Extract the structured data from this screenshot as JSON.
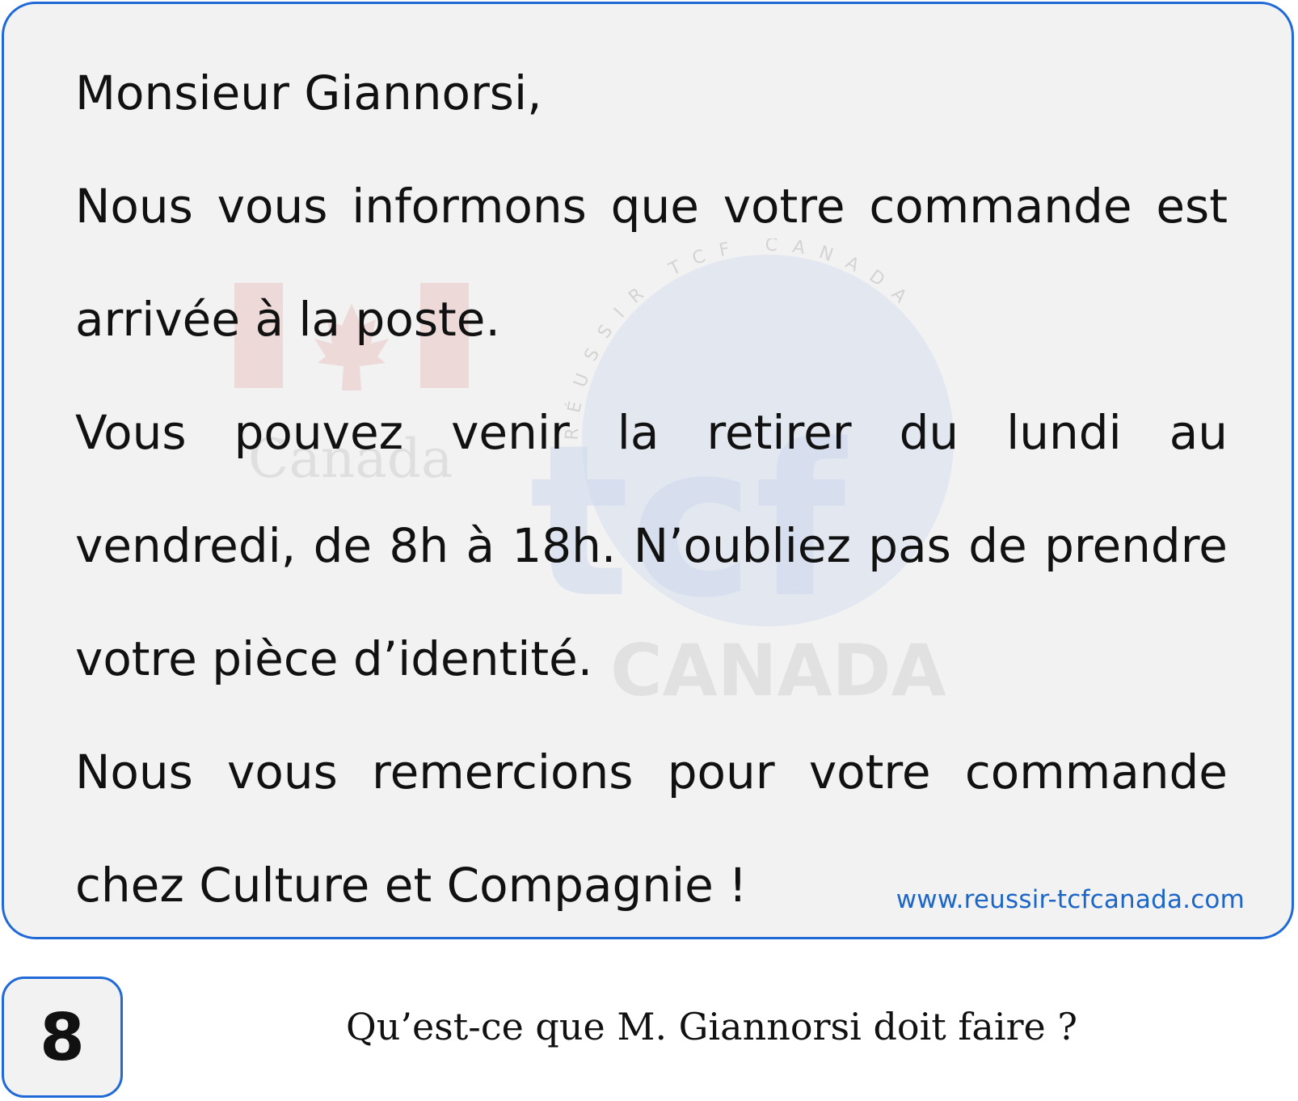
{
  "letter": {
    "greeting": "Monsieur Giannorsi,",
    "paragraph1": "Nous vous informons que votre commande est arrivée à la poste.",
    "paragraph2": "Vous pouvez venir la retirer du lundi au vendredi, de 8h à 18h. N’oubliez pas de prendre votre pièce d’identité.",
    "paragraph3": "Nous vous remercions pour votre commande chez Culture et Compagnie !"
  },
  "website": "www.reussir-tcfcanada.com",
  "watermark": {
    "canada_wordmark": "Canada",
    "logo_text": "tcf",
    "logo_subtext": "CANADA",
    "ring_text": "RÉUSSIR TCF CANADA"
  },
  "question": {
    "number": "8",
    "text": "Qu’est-ce que M. Giannorsi doit faire ?"
  },
  "colors": {
    "border": "#1f6ad6",
    "card_background": "#f2f2f2",
    "link": "#1c66c8",
    "text": "#111111"
  }
}
